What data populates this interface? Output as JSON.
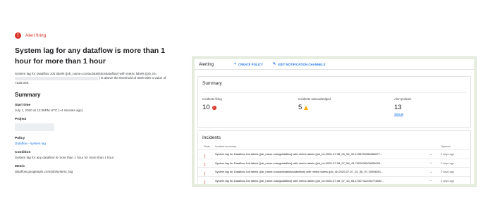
{
  "alert": {
    "status": "Alert firing",
    "title": "System lag for any dataflow is more than 1 hour for more than 1 hour",
    "description_part1": "System lag for Dataflow Job labels {job_name=contactstatisticsdataflow} with metric labels {job_id=",
    "description_part2": "} is above the threshold of 3600 with a value of 7228.000.",
    "summary_heading": "Summary",
    "start_time_label": "Start time",
    "start_time_value": "July 1, 2020 at 12:36PM UTC (~4 minutes ago)",
    "project_label": "Project",
    "policy_label": "Policy",
    "policy_value": "Dataflow - system lag",
    "condition_label": "Condition",
    "condition_value": "System lag for any dataflow is more than 1 hour for more than 1 hour",
    "metric_label": "Metric",
    "metric_value": "dataflow.googleapis.com/job/system_lag"
  },
  "console": {
    "app_title": "Alerting",
    "create_policy": "CREATE POLICY",
    "edit_channels": "EDIT NOTIFICATION CHANNELS",
    "summary_title": "Summary",
    "metrics": [
      {
        "label": "Incidents firing",
        "value": "10",
        "status": "error"
      },
      {
        "label": "Incidents acknowledged",
        "value": "5",
        "status": "warning"
      },
      {
        "label": "Alert policies",
        "value": "13",
        "link": "View all"
      }
    ],
    "incidents_title": "Incidents",
    "columns": {
      "state": "State",
      "summary": "Incident summary",
      "opened": "Opened"
    },
    "incidents": [
      {
        "summary": "System lag for Dataflow Job labels {job_name=clangdataflow} with metric labels {job_id=2020-07-08_09_54_32-1196799359856877...",
        "opened": "2 days ago"
      },
      {
        "summary": "System lag for Dataflow Job labels {job_name=clangdataflow} with metric labels {job_id=2020-07-08_07_56_43-7402634208956094...",
        "opened": "2 days ago"
      },
      {
        "summary": "System lag for Dataflow Job labels {job_name=contactstatisticsdataflow} with metric labels {job_id=2020-07-07_02_36_07-15594891...",
        "opened": "2 days ago"
      },
      {
        "summary": "System lag for Dataflow Job labels {job_name=clangdataflow} with metric labels {job_id=2020-07-08_07_43_55-17527412054778032...",
        "opened": "2 days ago"
      }
    ]
  },
  "colors": {
    "error": "#d93025",
    "warning": "#f9ab00",
    "link": "#1a73e8",
    "frame": "#e6eee0"
  }
}
